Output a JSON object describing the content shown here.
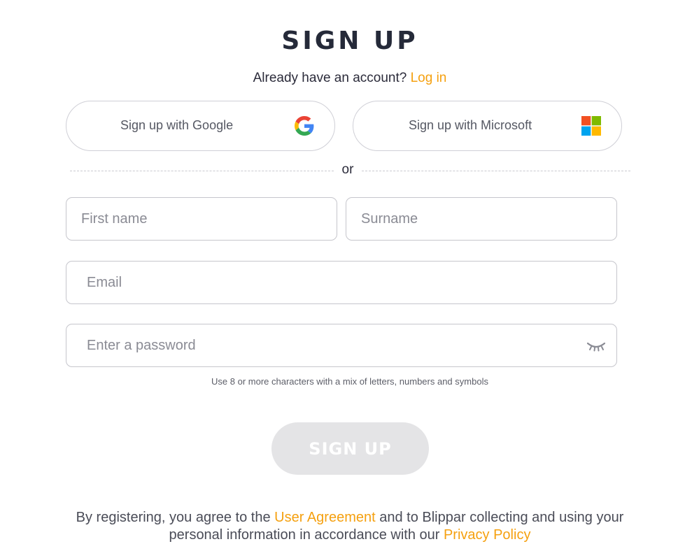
{
  "header": {
    "title": "SIGN UP",
    "login_prompt": "Already have an account?",
    "login_link": "Log in"
  },
  "sso": {
    "google_label": "Sign up with Google",
    "google_icon": "google-g-icon",
    "microsoft_label": "Sign up with Microsoft",
    "microsoft_icon": "microsoft-logo-icon"
  },
  "divider": {
    "text": "or"
  },
  "form": {
    "first_name": {
      "placeholder": "First name",
      "value": ""
    },
    "surname": {
      "placeholder": "Surname",
      "value": ""
    },
    "email": {
      "placeholder": "Email",
      "value": ""
    },
    "password": {
      "placeholder": "Enter a password",
      "value": "",
      "toggle_icon": "eye-closed-icon"
    },
    "password_hint": "Use 8 or more characters with a mix of letters, numbers and symbols",
    "submit_label": "SIGN UP"
  },
  "legal": {
    "prefix": "By registering, you agree to the",
    "user_agreement_link": "User Agreement",
    "middle": "and to Blippar collecting and using your personal information in accordance with our",
    "privacy_policy_link": "Privacy Policy"
  },
  "colors": {
    "accent": "#f5a00f",
    "title": "#252a39",
    "disabled_button": "#e4e4e6"
  }
}
